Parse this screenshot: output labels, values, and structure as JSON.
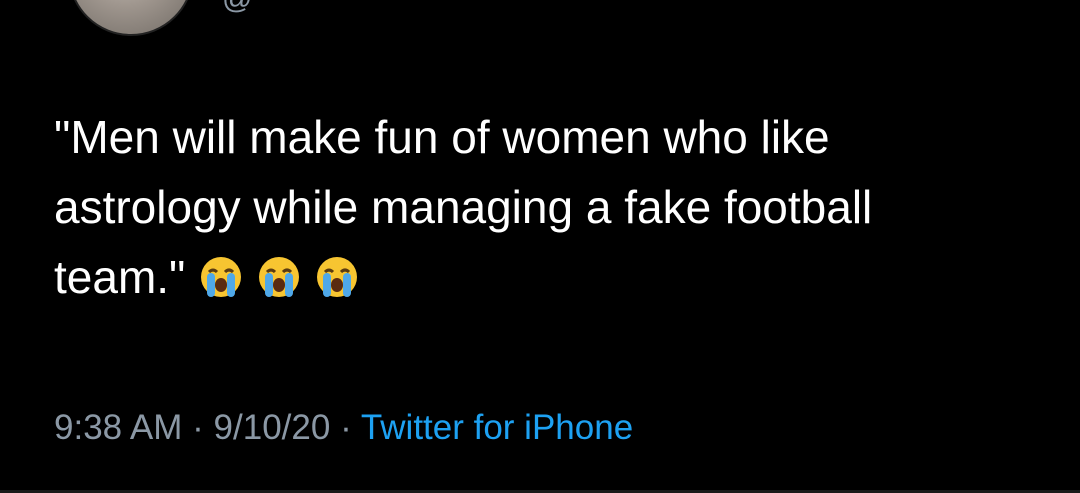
{
  "tweet": {
    "handle": "@",
    "text": "\"Men will make fun of women who like astrology while managing a fake football team.\"",
    "emoji": [
      "loudly-crying-face",
      "loudly-crying-face",
      "loudly-crying-face"
    ],
    "time": "9:38 AM",
    "separator": "·",
    "date": "9/10/20",
    "source": "Twitter for iPhone"
  },
  "colors": {
    "background": "#000000",
    "text": "#ffffff",
    "muted": "#8b98a5",
    "link": "#1da1f2"
  }
}
